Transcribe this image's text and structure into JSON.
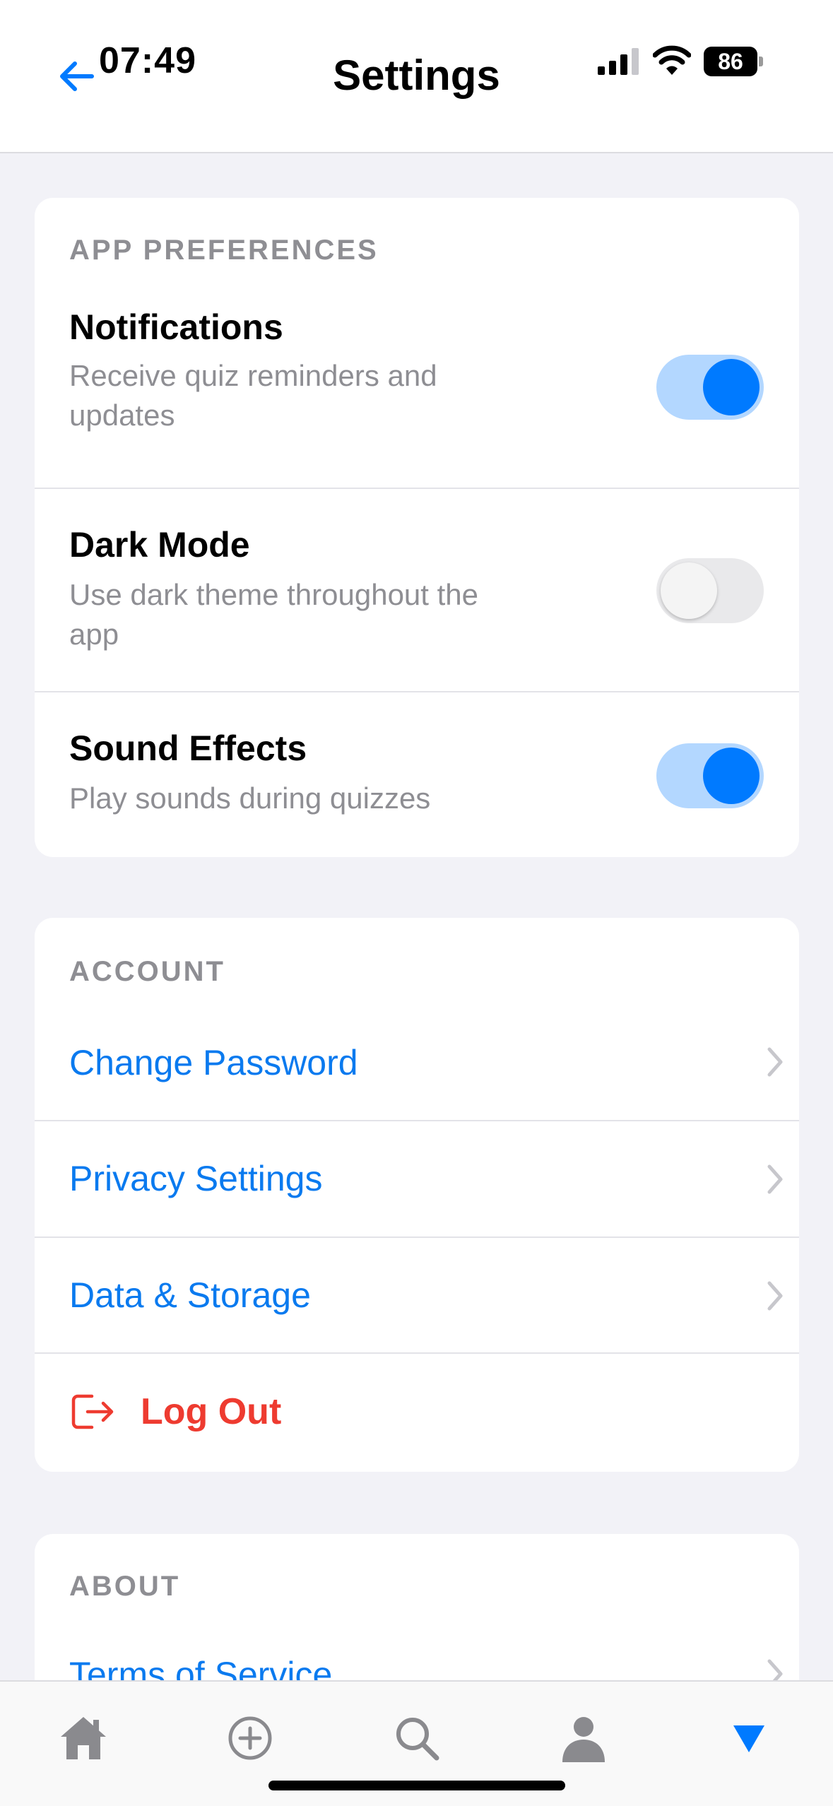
{
  "status_bar": {
    "time": "07:49",
    "battery": "86"
  },
  "header": {
    "title": "Settings"
  },
  "preferences": {
    "section_label": "APP PREFERENCES",
    "items": [
      {
        "title": "Notifications",
        "subtitle_line1": "Receive quiz reminders and",
        "subtitle_line2": "updates",
        "enabled": true
      },
      {
        "title": "Dark Mode",
        "subtitle_line1": "Use dark theme throughout the",
        "subtitle_line2": "app",
        "enabled": false
      },
      {
        "title": "Sound Effects",
        "subtitle_line1": "Play sounds during quizzes",
        "subtitle_line2": "",
        "enabled": true
      }
    ]
  },
  "account": {
    "section_label": "ACCOUNT",
    "items": [
      {
        "label": "Change Password"
      },
      {
        "label": "Privacy Settings"
      },
      {
        "label": "Data & Storage"
      }
    ],
    "logout_label": "Log Out"
  },
  "about": {
    "section_label": "ABOUT",
    "items": [
      {
        "label": "Terms of Service"
      }
    ]
  },
  "tabbar": {
    "icons": [
      "home-icon",
      "add-circle-icon",
      "search-icon",
      "profile-icon",
      "dropdown-triangle-icon"
    ]
  },
  "colors": {
    "accent": "#007AFF",
    "link": "#0A7AEF",
    "destructive": "#EE3B30",
    "background": "#F2F2F7",
    "secondary_text": "#8E8E93"
  }
}
